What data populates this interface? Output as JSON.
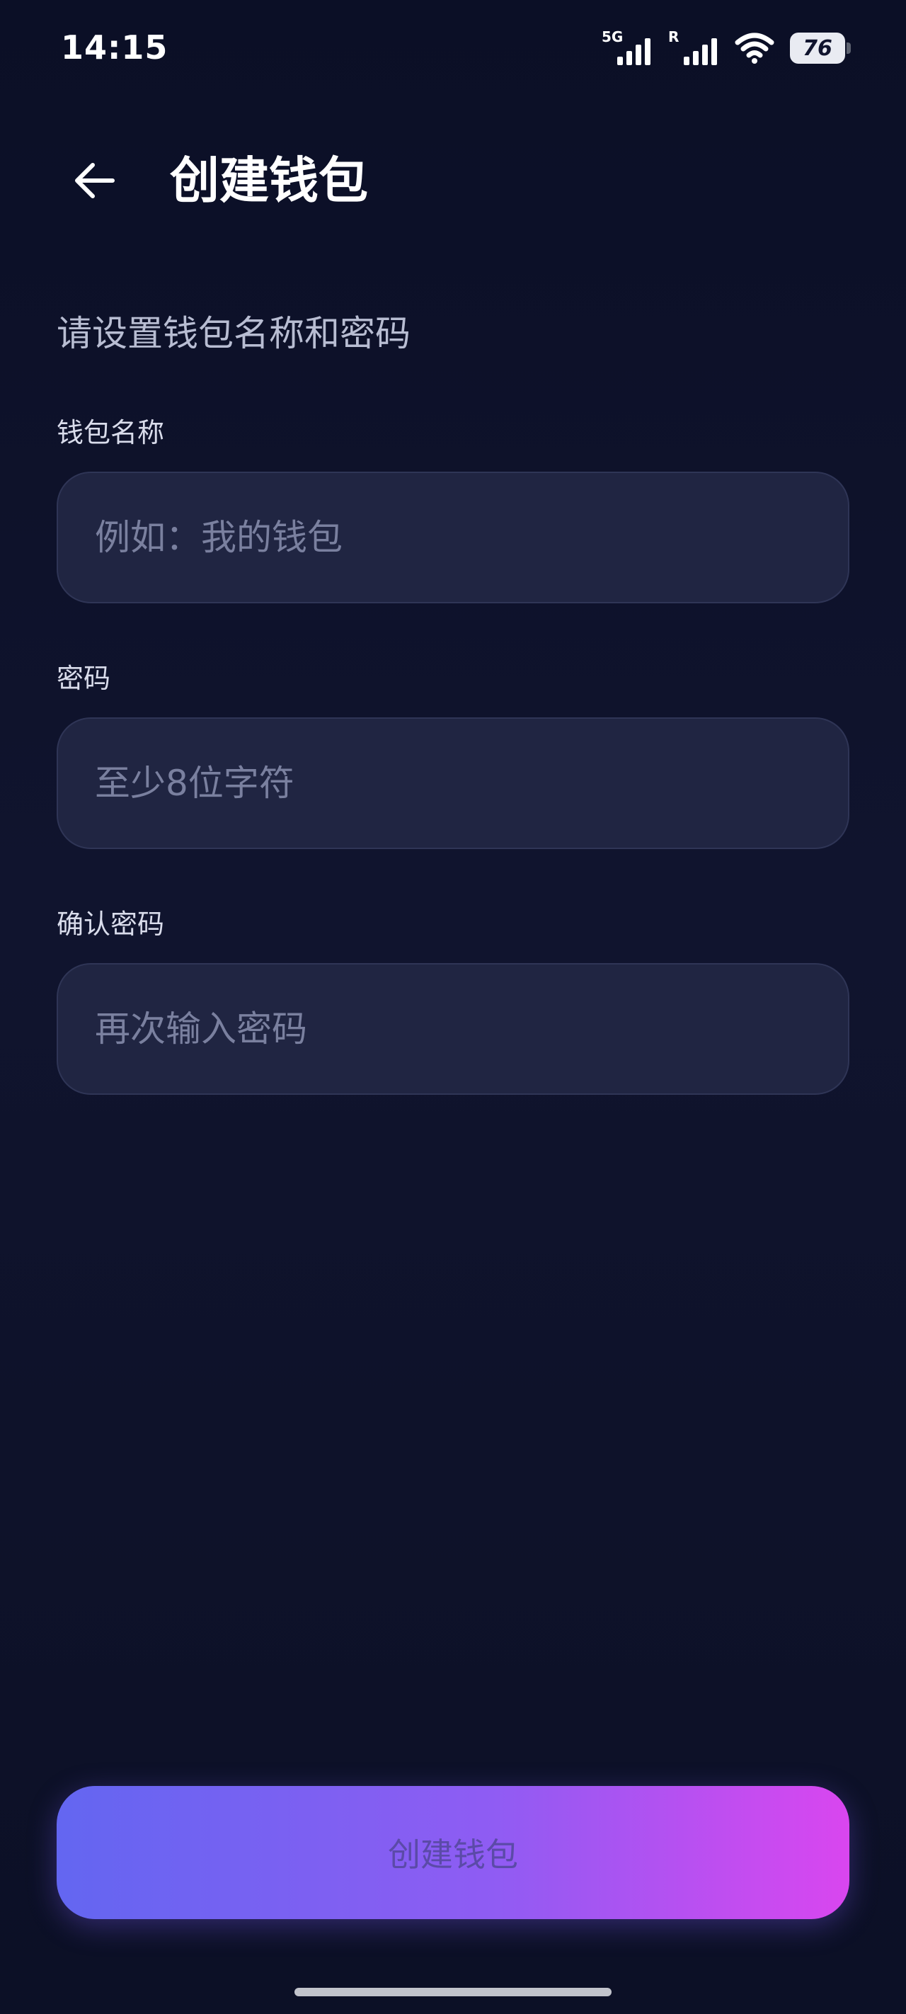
{
  "status_bar": {
    "time": "14:15",
    "network_primary": "5G",
    "network_secondary": "R",
    "battery": "76"
  },
  "header": {
    "title": "创建钱包",
    "back_icon": "arrow-left-icon"
  },
  "form": {
    "subtitle": "请设置钱包名称和密码",
    "wallet_name": {
      "label": "钱包名称",
      "placeholder": "例如：我的钱包"
    },
    "password": {
      "label": "密码",
      "placeholder": "至少8位字符"
    },
    "confirm_password": {
      "label": "确认密码",
      "placeholder": "再次输入密码"
    }
  },
  "submit": {
    "label": "创建钱包"
  },
  "colors": {
    "background": "#0b0f26",
    "input_background": "#202542",
    "gradient_start": "#6366f1",
    "gradient_end": "#d946ef"
  }
}
